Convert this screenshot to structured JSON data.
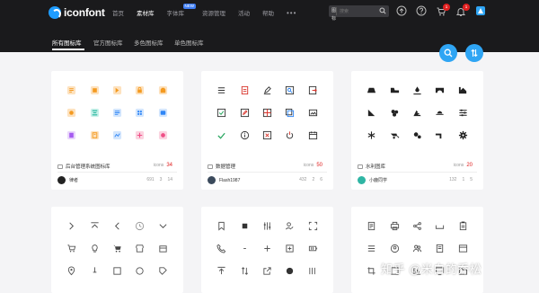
{
  "brand": {
    "logo_text": "iconfont",
    "accent": "#1e9cff"
  },
  "nav": {
    "items": [
      "首页",
      "素材库",
      "字体库",
      "资源管理",
      "活动",
      "帮助"
    ],
    "new_badge": "NEW",
    "more": "•••"
  },
  "search": {
    "type_label": "图标 ▾",
    "placeholder": "搜索"
  },
  "badges": {
    "cart": "1",
    "notifications": "1"
  },
  "subnav": {
    "tabs": [
      "所有图标库",
      "官方图标库",
      "多色图标库",
      "单色图标库"
    ]
  },
  "fab": {
    "search": "search-icon",
    "sort": "sort-icon"
  },
  "colors": {
    "accent": "#2fa5f4",
    "count": "#e02020",
    "header_bg": "#1a1a1c"
  },
  "cards": [
    {
      "name": "后台管理系统图标库",
      "count_label": "icons",
      "count": "34",
      "author": "律者",
      "stat_1": "691",
      "stat_2": "3",
      "stat_3": "14"
    },
    {
      "name": "数据管理",
      "count_label": "icons",
      "count": "50",
      "author": "Flash1987",
      "stat_1": "432",
      "stat_2": "2",
      "stat_3": "6"
    },
    {
      "name": "水利图库",
      "count_label": "icons",
      "count": "20",
      "author": "小鹿同学",
      "stat_1": "132",
      "stat_2": "1",
      "stat_3": "5"
    }
  ],
  "watermark": "知乎 @米白的乔松"
}
